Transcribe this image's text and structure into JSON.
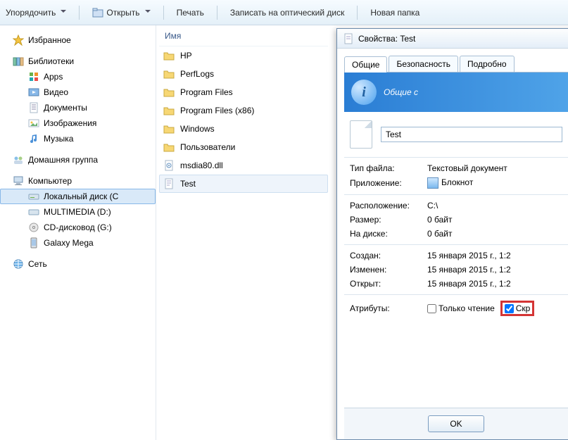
{
  "toolbar": {
    "organize": "Упорядочить",
    "open": "Открыть",
    "print": "Печать",
    "burn": "Записать на оптический диск",
    "newfolder": "Новая папка"
  },
  "nav": {
    "favorites": "Избранное",
    "libraries": "Библиотеки",
    "lib_items": {
      "apps": "Apps",
      "video": "Видео",
      "docs": "Документы",
      "images": "Изображения",
      "music": "Музыка"
    },
    "homegroup": "Домашняя группа",
    "computer": "Компьютер",
    "comp_items": {
      "cdrive": "Локальный диск (C",
      "ddrive": "MULTIMEDIA (D:)",
      "gdrive": "CD-дисковод (G:)",
      "galaxy": "Galaxy Mega"
    },
    "network": "Сеть"
  },
  "files": {
    "header": "Имя",
    "items": [
      "HP",
      "PerfLogs",
      "Program Files",
      "Program Files (x86)",
      "Windows",
      "Пользователи",
      "msdia80.dll",
      "Test"
    ]
  },
  "dialog": {
    "title": "Свойства: Test",
    "tabs": {
      "general": "Общие",
      "security": "Безопасность",
      "details": "Подробно"
    },
    "banner": "Общие с",
    "filename": "Test",
    "type_label": "Тип файла:",
    "type_value": "Текстовый документ",
    "app_label": "Приложение:",
    "app_value": "Блокнот",
    "loc_label": "Расположение:",
    "loc_value": "C:\\",
    "size_label": "Размер:",
    "size_value": "0 байт",
    "disk_label": "На диске:",
    "disk_value": "0 байт",
    "created_label": "Создан:",
    "created_value": "15 января 2015 г., 1:2",
    "modified_label": "Изменен:",
    "modified_value": "15 января 2015 г., 1:2",
    "opened_label": "Открыт:",
    "opened_value": "15 января 2015 г., 1:2",
    "attr_label": "Атрибуты:",
    "readonly": "Только чтение",
    "hidden": "Скр",
    "ok": "OK"
  }
}
